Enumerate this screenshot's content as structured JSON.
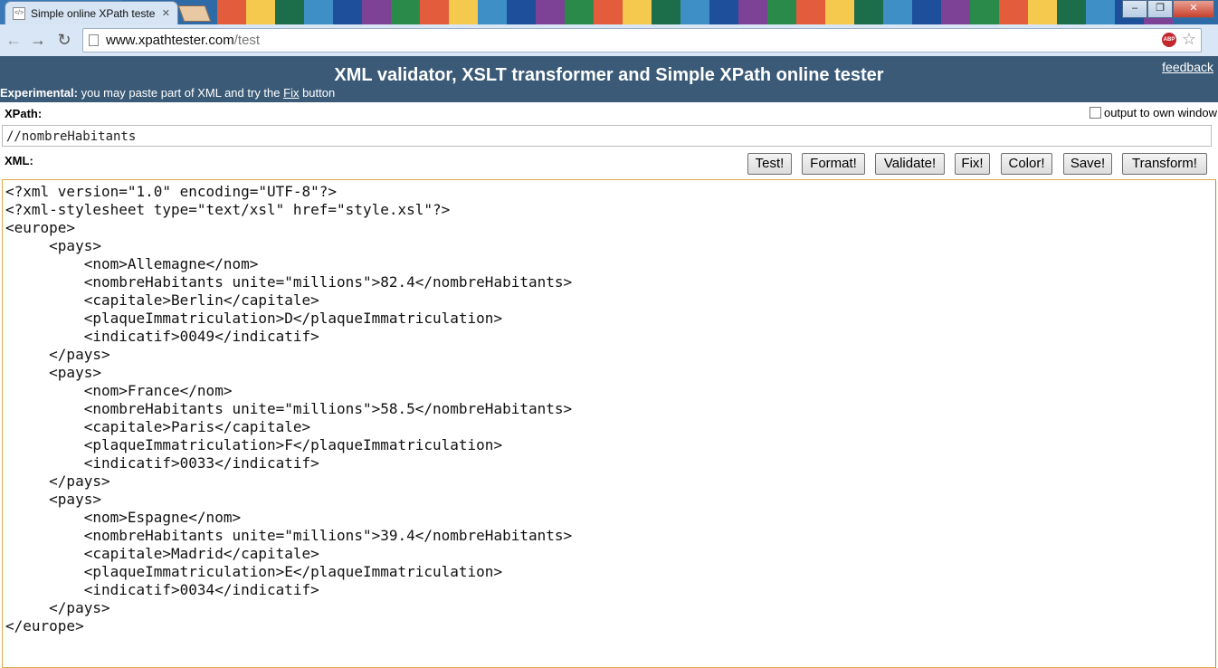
{
  "browser": {
    "tab_title": "Simple online XPath teste",
    "url_host": "www.xpathtester.com",
    "url_path": "/test"
  },
  "header": {
    "title": "XML validator, XSLT transformer and Simple XPath online tester",
    "feedback": "feedback",
    "experimental_label": "Experimental:",
    "experimental_text_1": " you may paste part of XML and try the ",
    "experimental_fix": "Fix",
    "experimental_text_2": " button"
  },
  "xpath": {
    "label": "XPath:",
    "value": "//nombreHabitants",
    "output_own_window": "output to own window"
  },
  "xml": {
    "label": "XML:",
    "buttons": {
      "test": "Test!",
      "format": "Format!",
      "validate": "Validate!",
      "fix": "Fix!",
      "color": "Color!",
      "save": "Save!",
      "transform": "Transform!"
    },
    "content": "<?xml version=\"1.0\" encoding=\"UTF-8\"?>\n<?xml-stylesheet type=\"text/xsl\" href=\"style.xsl\"?>\n<europe>\n     <pays>\n         <nom>Allemagne</nom>\n         <nombreHabitants unite=\"millions\">82.4</nombreHabitants>\n         <capitale>Berlin</capitale>\n         <plaqueImmatriculation>D</plaqueImmatriculation>\n         <indicatif>0049</indicatif>\n     </pays>\n     <pays>\n         <nom>France</nom>\n         <nombreHabitants unite=\"millions\">58.5</nombreHabitants>\n         <capitale>Paris</capitale>\n         <plaqueImmatriculation>F</plaqueImmatriculation>\n         <indicatif>0033</indicatif>\n     </pays>\n     <pays>\n         <nom>Espagne</nom>\n         <nombreHabitants unite=\"millions\">39.4</nombreHabitants>\n         <capitale>Madrid</capitale>\n         <plaqueImmatriculation>E</plaqueImmatriculation>\n         <indicatif>0034</indicatif>\n     </pays>\n</europe>"
  },
  "colors": {
    "header_bg": "#3a5a77",
    "editor_border": "#e0a94d"
  }
}
